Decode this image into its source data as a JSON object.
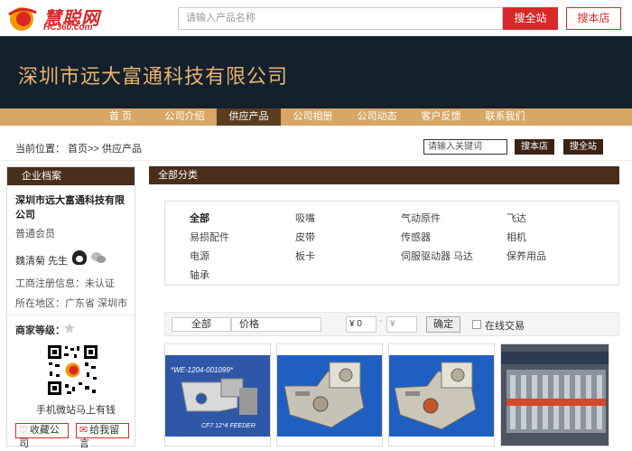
{
  "topbar": {
    "logo_cn": "慧聪网",
    "logo_en": "HC360.com",
    "search_placeholder": "请输入产品名称",
    "search_all_btn": "搜全站",
    "search_shop_btn": "搜本店"
  },
  "banner": {
    "company_name": "深圳市远大富通科技有限公司"
  },
  "nav": {
    "items": [
      "首 页",
      "公司介绍",
      "供应产品",
      "公司相册",
      "公司动态",
      "客户反馈",
      "联系我们"
    ],
    "active_index": 2
  },
  "breadcrumb": {
    "text": "当前位置： 首页>> 供应产品",
    "search_placeholder": "请输入关键词",
    "btn_shop": "搜本店",
    "btn_all": "搜全站"
  },
  "sidebar": {
    "header": "企业档案",
    "company": "深圳市远大富通科技有限公司",
    "member": "普通会员",
    "person": "魏清菊  先生",
    "registration": "工商注册信息：未认证",
    "area": "所在地区：广东省 深圳市",
    "level_label": "商家等级：",
    "qr_caption": "手机微站马上有钱",
    "fav_btn": "收藏公司",
    "msg_btn": "给我留言",
    "icons": [
      "qq-icon",
      "wechat-icon",
      "level-icon",
      "heart-icon",
      "message-icon"
    ]
  },
  "main": {
    "header": "全部分类",
    "categories": [
      [
        "全部",
        "吸嘴",
        "气动原件",
        "飞达"
      ],
      [
        "易损配件",
        "皮带",
        "传感器",
        "相机"
      ],
      [
        "电源",
        "板卡",
        "伺服驱动器 马达",
        "保养用品"
      ],
      [
        "轴承"
      ]
    ],
    "filter": {
      "tab_all": "全部",
      "tab_price": "价格",
      "price_min": "¥ 0",
      "price_dash": "-",
      "price_max": "¥",
      "confirm": "确定",
      "online_trade": "在线交易"
    },
    "product_labels": [
      "*WE-1204-001099*",
      "CF7 12*4 FEEDER"
    ]
  },
  "colors": {
    "brand_red": "#d9282a",
    "banner_bg": "#13202e",
    "banner_text": "#e9b36a",
    "nav_bg": "#d7a766",
    "nav_active": "#5b3e22",
    "panel_head": "#4a2e1b"
  }
}
